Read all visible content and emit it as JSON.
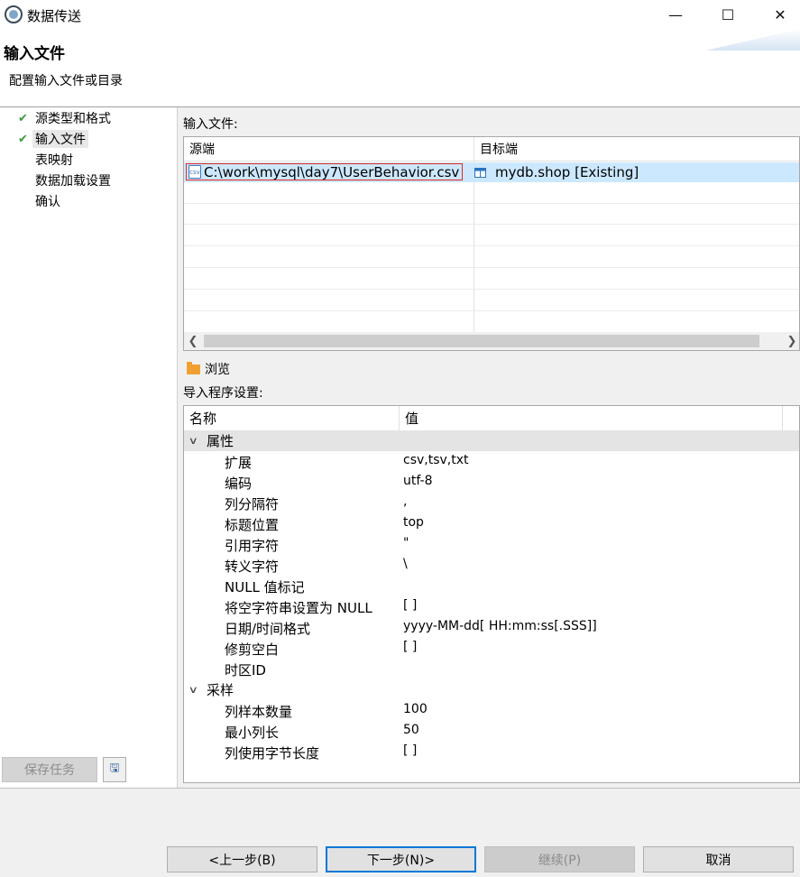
{
  "window": {
    "title": "数据传送",
    "minimize": "—",
    "maximize": "☐",
    "close": "✕"
  },
  "header": {
    "title": "输入文件",
    "subtitle": "配置输入文件或目录"
  },
  "steps": [
    {
      "label": "源类型和格式",
      "done": true
    },
    {
      "label": "输入文件",
      "done": true,
      "active": true
    },
    {
      "label": "表映射",
      "done": false
    },
    {
      "label": "数据加载设置",
      "done": false
    },
    {
      "label": "确认",
      "done": false
    }
  ],
  "left_buttons": {
    "save_task": "保存任务",
    "save_icon": "🖫"
  },
  "input_files": {
    "label": "输入文件:",
    "columns": [
      "源端",
      "目标端"
    ],
    "rows": [
      {
        "source": "C:\\work\\mysql\\day7\\UserBehavior.csv",
        "target": "mydb.shop [Existing]",
        "source_icon": "csv",
        "target_icon": "table-icon"
      }
    ]
  },
  "browse_label": "浏览",
  "importer": {
    "label": "导入程序设置:",
    "columns": [
      "名称",
      "值"
    ],
    "groups": [
      {
        "name": "属性",
        "items": [
          {
            "name": "扩展",
            "value": "csv,tsv,txt"
          },
          {
            "name": "编码",
            "value": "utf-8"
          },
          {
            "name": "列分隔符",
            "value": ","
          },
          {
            "name": "标题位置",
            "value": "top"
          },
          {
            "name": "引用字符",
            "value": "\""
          },
          {
            "name": "转义字符",
            "value": "\\"
          },
          {
            "name": "NULL 值标记",
            "value": ""
          },
          {
            "name": "将空字符串设置为 NULL",
            "value": "[ ]"
          },
          {
            "name": "日期/时间格式",
            "value": "yyyy-MM-dd[ HH:mm:ss[.SSS]]"
          },
          {
            "name": "修剪空白",
            "value": "[ ]"
          },
          {
            "name": "时区ID",
            "value": ""
          }
        ]
      },
      {
        "name": "采样",
        "items": [
          {
            "name": "列样本数量",
            "value": "100"
          },
          {
            "name": "最小列长",
            "value": "50"
          },
          {
            "name": "列使用字节长度",
            "value": "[ ]"
          }
        ]
      }
    ]
  },
  "footer": {
    "back": "<上一步(B)",
    "next": "下一步(N)>",
    "continue": "继续(P)",
    "cancel": "取消"
  }
}
